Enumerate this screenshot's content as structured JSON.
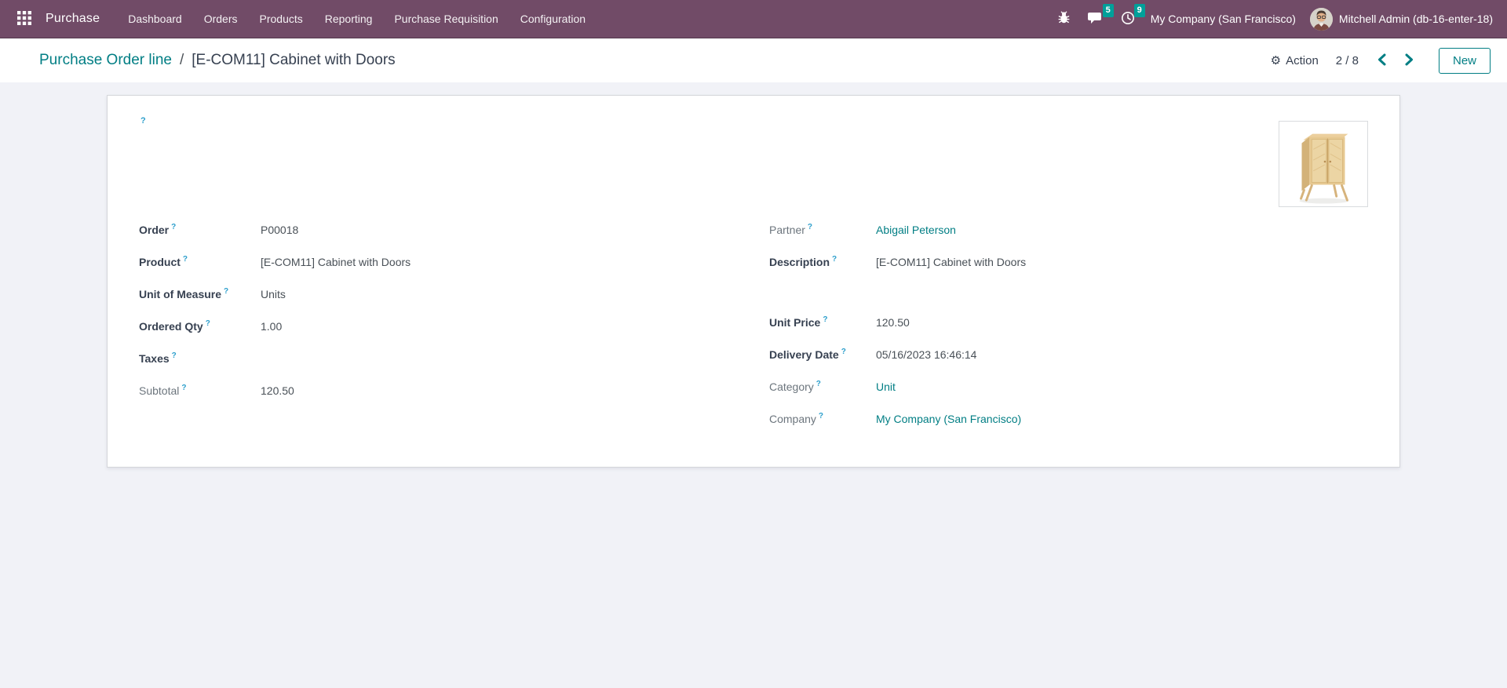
{
  "navbar": {
    "brand": "Purchase",
    "menus": [
      "Dashboard",
      "Orders",
      "Products",
      "Reporting",
      "Purchase Requisition",
      "Configuration"
    ],
    "message_badge": "5",
    "activity_badge": "9",
    "company": "My Company (San Francisco)",
    "user": "Mitchell Admin (db-16-enter-18)"
  },
  "control_panel": {
    "breadcrumb_parent": "Purchase Order line",
    "breadcrumb_separator": "/",
    "breadcrumb_current": "[E-COM11] Cabinet with Doors",
    "action_icon_glyph": "⚙",
    "action_label": "Action",
    "pager": "2 / 8",
    "new_label": "New"
  },
  "form": {
    "help_marker": "?",
    "left": [
      {
        "label": "Order",
        "value": "P00018"
      },
      {
        "label": "Product",
        "value": "[E-COM11] Cabinet with Doors"
      },
      {
        "label": "Unit of Measure",
        "value": "Units"
      },
      {
        "label": "Ordered Qty",
        "value": "1.00"
      },
      {
        "label": "Taxes",
        "value": ""
      },
      {
        "label": "Subtotal",
        "value": "120.50"
      }
    ],
    "right": [
      {
        "label": "Partner",
        "value": "Abigail Peterson"
      },
      {
        "label": "Description",
        "value": "[E-COM11] Cabinet with Doors"
      },
      {
        "label": "Unit Price",
        "value": "120.50"
      },
      {
        "label": "Delivery Date",
        "value": "05/16/2023 16:46:14"
      },
      {
        "label": "Category",
        "value": "Unit"
      },
      {
        "label": "Company",
        "value": "My Company (San Francisco)"
      }
    ]
  },
  "icons": {
    "apps": "grid-icon",
    "debug": "bug-icon",
    "messages": "chat-icon",
    "activities": "clock-icon",
    "action": "gear-icon",
    "prev": "chevron-left-icon",
    "next": "chevron-right-icon",
    "product": "cabinet-product-image"
  },
  "colors": {
    "navbar_bg": "#714B67",
    "accent_teal": "#017e84",
    "badge_teal": "#00a09a",
    "help_blue": "#2d9fcc",
    "page_bg": "#f1f2f7"
  }
}
